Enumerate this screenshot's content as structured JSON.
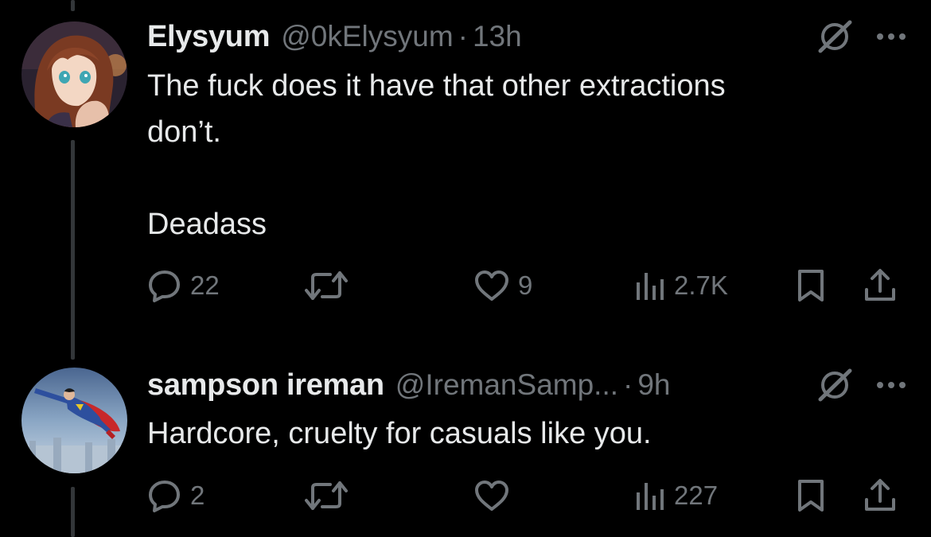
{
  "colors": {
    "background": "#000000",
    "text_primary": "#e7e9ea",
    "text_secondary": "#71767b",
    "thread_line": "#333639"
  },
  "tweets": [
    {
      "display_name": "Elysyum",
      "handle": "@0kElysyum",
      "separator": "·",
      "time": "13h",
      "text": "The fuck does it have that other extractions\ndon’t.\n\nDeadass",
      "actions": {
        "replies": "22",
        "reposts": "",
        "likes": "9",
        "views": "2.7K"
      },
      "icons": [
        "grok-icon",
        "more-icon",
        "reply-icon",
        "repost-icon",
        "like-icon",
        "views-icon",
        "bookmark-icon",
        "share-icon"
      ]
    },
    {
      "display_name": "sampson ireman",
      "handle": "@IremanSamp...",
      "separator": "·",
      "time": "9h",
      "text": "Hardcore, cruelty for casuals like you.",
      "actions": {
        "replies": "2",
        "reposts": "",
        "likes": "",
        "views": "227"
      },
      "icons": [
        "grok-icon",
        "more-icon",
        "reply-icon",
        "repost-icon",
        "like-icon",
        "views-icon",
        "bookmark-icon",
        "share-icon"
      ]
    }
  ]
}
